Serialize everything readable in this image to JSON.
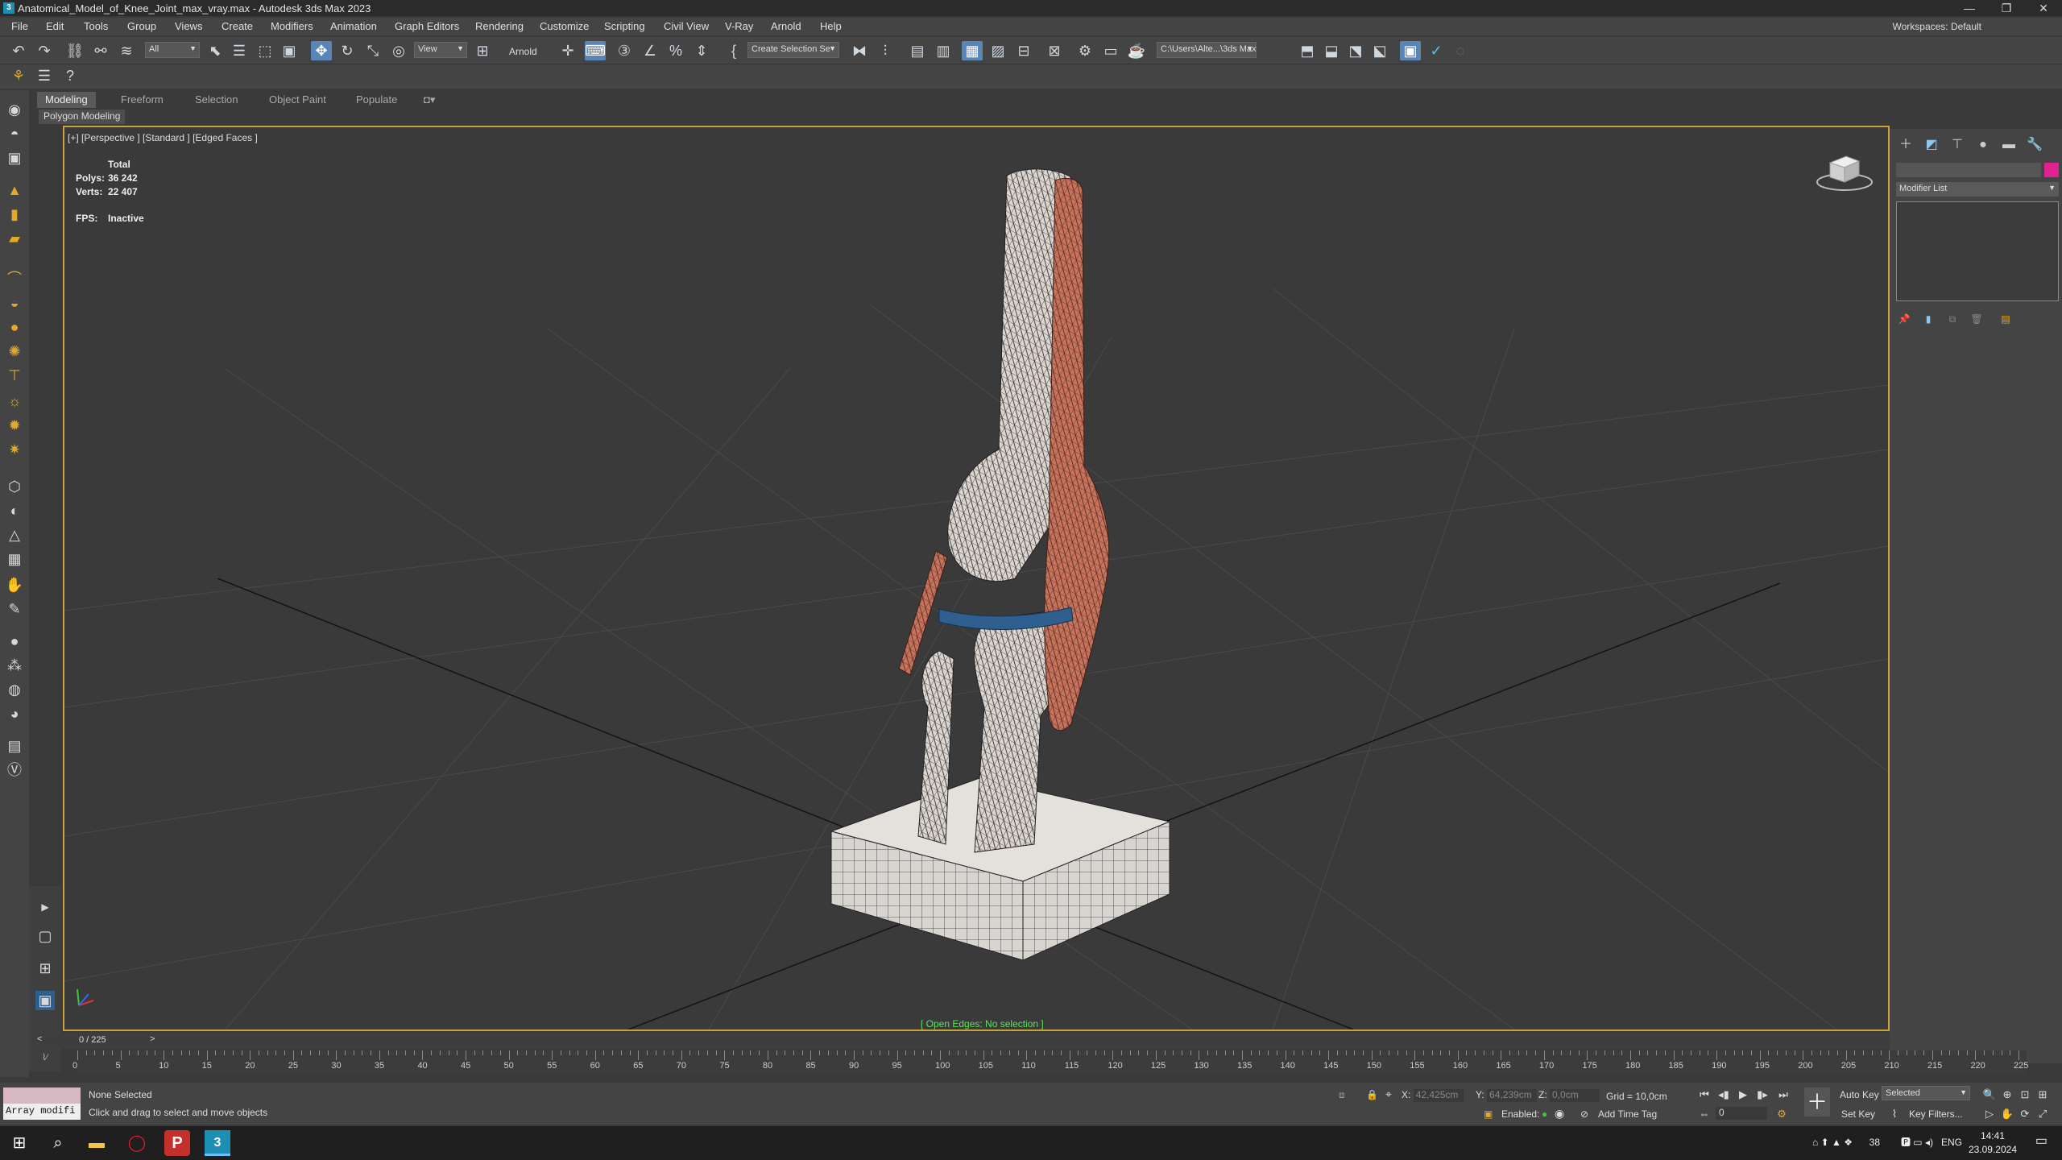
{
  "window": {
    "title": "Anatomical_Model_of_Knee_Joint_max_vray.max - Autodesk 3ds Max 2023",
    "app_icon": "3",
    "minimize": "—",
    "restore": "❐",
    "close": "✕"
  },
  "menu": {
    "items": [
      "File",
      "Edit",
      "Tools",
      "Group",
      "Views",
      "Create",
      "Modifiers",
      "Animation",
      "Graph Editors",
      "Rendering",
      "Customize",
      "Scripting",
      "Civil View",
      "V-Ray",
      "Arnold",
      "Help"
    ],
    "workspaces_label": "Workspaces:",
    "workspaces_value": "Default"
  },
  "toolbar": {
    "selection_filter": "All",
    "ref_coord": "View",
    "arnold_label": "Arnold",
    "named_selection": "Create Selection Se",
    "project_path": "C:\\Users\\Alte...\\3ds Max 202"
  },
  "ribbon": {
    "tabs": [
      "Modeling",
      "Freeform",
      "Selection",
      "Object Paint",
      "Populate"
    ],
    "active_tab": "Modeling",
    "panel": "Polygon Modeling"
  },
  "viewport": {
    "label": "[+] [Perspective ] [Standard ] [Edged Faces ]",
    "stats_header": "Total",
    "polys_label": "Polys:",
    "polys_value": "36 242",
    "verts_label": "Verts:",
    "verts_value": "22 407",
    "fps_label": "FPS:",
    "fps_value": "Inactive",
    "open_edges": "[ Open Edges: No selection ]"
  },
  "command_panel": {
    "modifier_list": "Modifier List",
    "color": "#e02290"
  },
  "timeline": {
    "frame_display": "0 / 225",
    "ticks": [
      0,
      5,
      10,
      15,
      20,
      25,
      30,
      35,
      40,
      45,
      50,
      55,
      60,
      65,
      70,
      75,
      80,
      85,
      90,
      95,
      100,
      105,
      110,
      115,
      120,
      125,
      130,
      135,
      140,
      145,
      150,
      155,
      160,
      165,
      170,
      175,
      180,
      185,
      190,
      195,
      200,
      205,
      210,
      215,
      220,
      225
    ]
  },
  "status": {
    "maxscript_input": "Array modifi",
    "selection": "None Selected",
    "prompt": "Click and drag to select and move objects",
    "x_label": "X:",
    "x_value": "42,425cm",
    "y_label": "Y:",
    "y_value": "64,239cm",
    "z_label": "Z:",
    "z_value": "0,0cm",
    "grid": "Grid = 10,0cm",
    "enabled_label": "Enabled:",
    "add_time_tag": "Add Time Tag",
    "auto_key": "Auto Key",
    "set_key": "Set Key",
    "selected_dd": "Selected",
    "key_filters": "Key Filters...",
    "frame_field": "0"
  },
  "taskbar": {
    "temperature": "38",
    "language": "ENG",
    "time": "14:41",
    "date": "23.09.2024"
  }
}
